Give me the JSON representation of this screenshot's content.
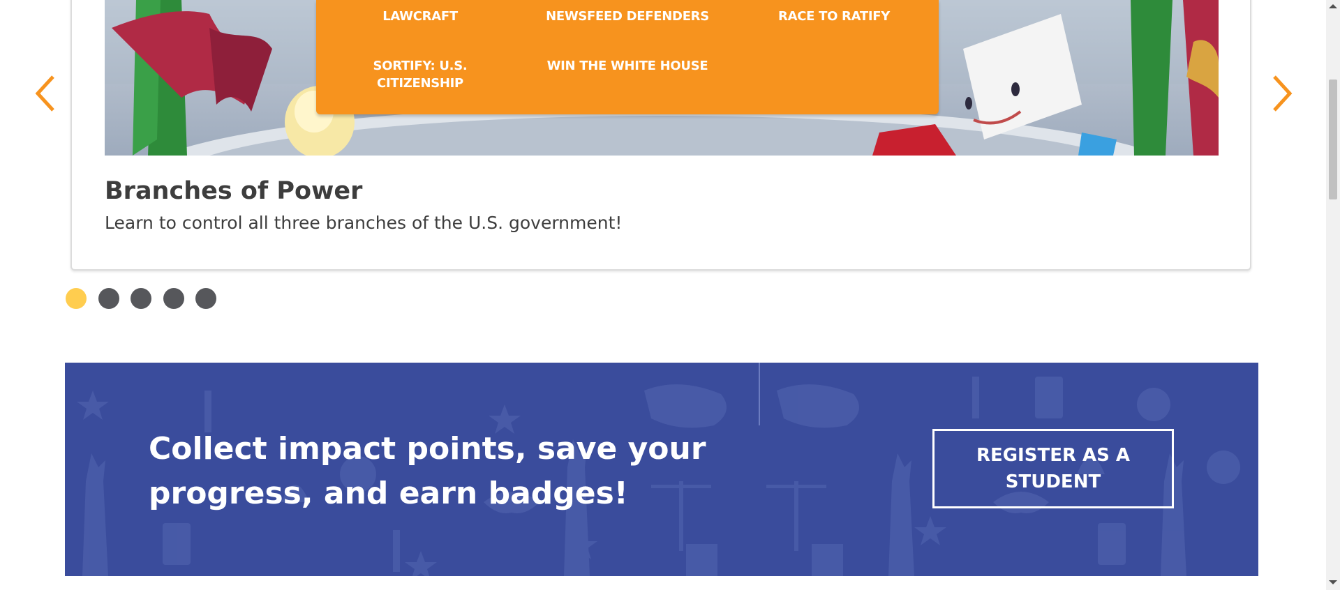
{
  "carousel": {
    "games": [
      {
        "label": "LAWCRAFT"
      },
      {
        "label": "NEWSFEED DEFENDERS"
      },
      {
        "label": "RACE TO RATIFY"
      },
      {
        "label": "SORTIFY: U.S. CITIZENSHIP"
      },
      {
        "label": "WIN THE WHITE HOUSE"
      }
    ],
    "current_slide": {
      "title": "Branches of Power",
      "description": "Learn to control all three branches of the U.S. government!"
    },
    "dots_count": 5,
    "active_dot": 1,
    "arrow_color": "#f7931e",
    "panel_color": "#f7931e"
  },
  "banner": {
    "headline": "Collect impact points, save your progress, and earn badges!",
    "register_button": "REGISTER AS A STUDENT",
    "background_color": "#3a4c9c"
  },
  "icons": {
    "prev": "chevron-left-icon",
    "next": "chevron-right-icon"
  }
}
